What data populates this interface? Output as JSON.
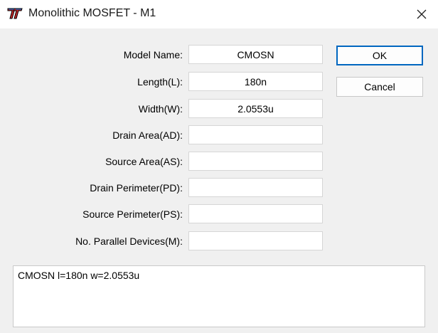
{
  "window": {
    "title": "Monolithic MOSFET - M1",
    "accent": "#0067c0"
  },
  "fields": [
    {
      "label": "Model Name:",
      "value": "CMOSN"
    },
    {
      "label": "Length(L):",
      "value": "180n"
    },
    {
      "label": "Width(W):",
      "value": "2.0553u"
    },
    {
      "label": "Drain Area(AD):",
      "value": ""
    },
    {
      "label": "Source Area(AS):",
      "value": ""
    },
    {
      "label": "Drain Perimeter(PD):",
      "value": ""
    },
    {
      "label": "Source Perimeter(PS):",
      "value": ""
    },
    {
      "label": "No. Parallel Devices(M):",
      "value": ""
    }
  ],
  "buttons": {
    "ok_label": "OK",
    "cancel_label": "Cancel"
  },
  "description": "CMOSN l=180n w=2.0553u",
  "icons": {
    "app": "ltspice-app-icon",
    "close": "close-icon"
  }
}
